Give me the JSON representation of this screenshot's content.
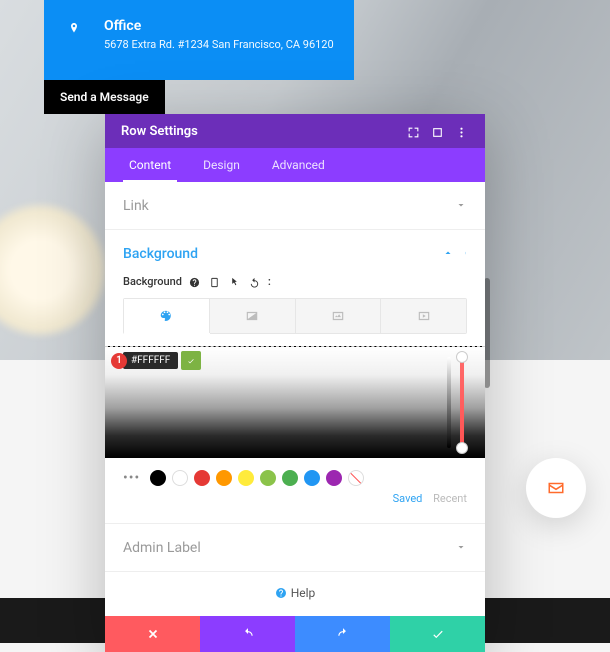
{
  "office": {
    "title": "Office",
    "address": "5678 Extra Rd. #1234 San Francisco, CA 96120"
  },
  "send_label": "Send a Message",
  "modal": {
    "title": "Row Settings",
    "tabs": {
      "content": "Content",
      "design": "Design",
      "advanced": "Advanced"
    },
    "sections": {
      "link": "Link",
      "background": "Background",
      "admin": "Admin Label"
    },
    "bg_label": "Background",
    "color_value": "#FFFFFF",
    "swatches": [
      "#000000",
      "#ffffff",
      "#e53935",
      "#ff9800",
      "#ffeb3b",
      "#8bc34a",
      "#4caf50",
      "#2196f3",
      "#9c27b0"
    ],
    "saved": "Saved",
    "recent": "Recent",
    "help": "Help"
  }
}
